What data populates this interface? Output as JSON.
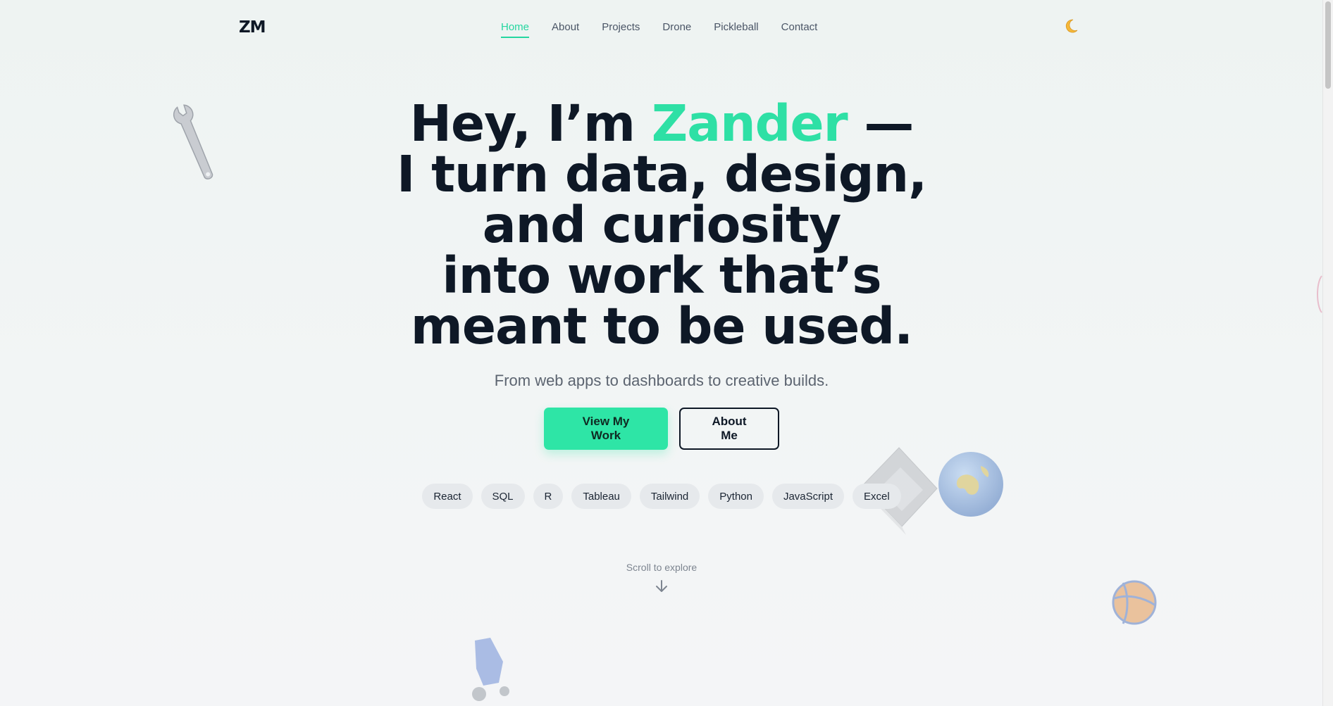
{
  "header": {
    "logo": "ZM",
    "nav": [
      {
        "label": "Home",
        "active": true
      },
      {
        "label": "About"
      },
      {
        "label": "Projects"
      },
      {
        "label": "Drone"
      },
      {
        "label": "Pickleball"
      },
      {
        "label": "Contact"
      }
    ],
    "theme_toggle_icon": "moon-icon"
  },
  "hero": {
    "title_prefix": "Hey, I’m ",
    "title_name": "Zander",
    "title_dash": " —",
    "title_line2": "I turn data, design,",
    "title_line3": "and curiosity",
    "title_line4": "into work that’s",
    "title_line5": "meant to be used.",
    "subtitle": "From web apps to dashboards to creative builds.",
    "primary_button": "View My Work",
    "secondary_button": "About Me",
    "tags": [
      "React",
      "SQL",
      "R",
      "Tableau",
      "Tailwind",
      "Python",
      "JavaScript",
      "Excel"
    ]
  },
  "scroll_hint": "Scroll to explore",
  "colors": {
    "accent": "#2ee0a5",
    "text_dark": "#0e1826",
    "muted": "#5c6470"
  },
  "decor": [
    "wrench-icon",
    "laptop-icon",
    "globe-icon",
    "basketball-icon",
    "drone-icon"
  ]
}
